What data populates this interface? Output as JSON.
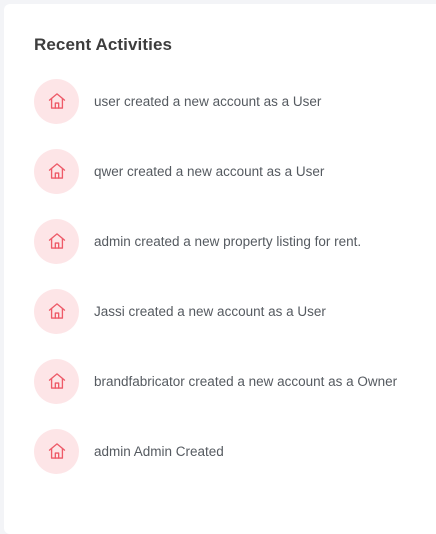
{
  "card": {
    "title": "Recent Activities"
  },
  "activities": [
    {
      "icon": "home-icon",
      "text": "user created a new account as a User"
    },
    {
      "icon": "home-icon",
      "text": "qwer created a new account as a User"
    },
    {
      "icon": "home-icon",
      "text": "admin created a new property listing for rent."
    },
    {
      "icon": "home-icon",
      "text": "Jassi created a new account as a User"
    },
    {
      "icon": "home-icon",
      "text": "brandfabricator created a new account as a Owner"
    },
    {
      "icon": "home-icon",
      "text": "admin Admin Created"
    }
  ],
  "colors": {
    "icon_bg": "#fde5e7",
    "icon_stroke": "#ee5a68",
    "title": "#3d3d3d",
    "text": "#555a60"
  }
}
